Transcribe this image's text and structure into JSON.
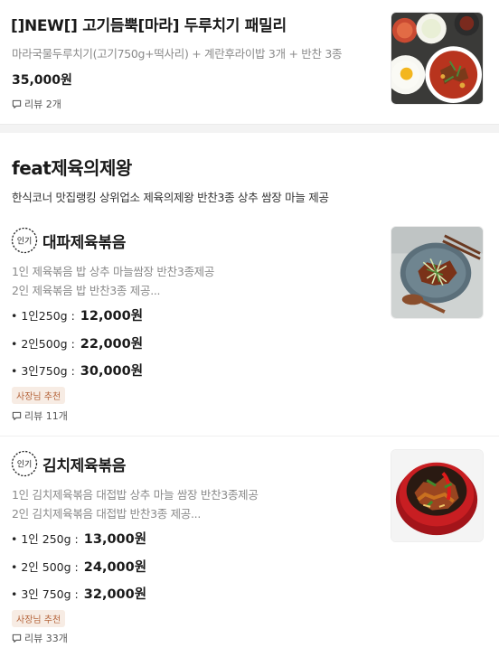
{
  "top_item": {
    "title": "[]NEW[] 고기듬뿍[마라] 두루치기 패밀리",
    "description": "마라국물두루치기(고기750g+떡사리) + 계란후라이밥 3개 + 반찬 3종",
    "price": "35,000원",
    "review": "리뷰 2개"
  },
  "section": {
    "title": "feat제육의제왕",
    "description": "한식코너 맛집랭킹 상위업소 제육의제왕  반찬3종 상추 쌈장 마늘 제공"
  },
  "menu_items": [
    {
      "badge": "인기",
      "title": "대파제육볶음",
      "description_lines": [
        "1인 제육볶음 밥 상추 마늘쌈장 반찬3종제공",
        "2인 제육볶음 밥 반찬3종 제공..."
      ],
      "options": [
        {
          "label": "• 1인250g :",
          "price": "12,000원"
        },
        {
          "label": "• 2인500g :",
          "price": "22,000원"
        },
        {
          "label": "• 3인750g :",
          "price": "30,000원"
        }
      ],
      "owner_badge": "사장님 추천",
      "review": "리뷰 11개"
    },
    {
      "badge": "인기",
      "title": "김치제육볶음",
      "description_lines": [
        "1인 김치제육볶음 대접밥 상추 마늘 쌈장 반찬3종제공",
        "2인 김치제육볶음 대접밥 반찬3종 제공..."
      ],
      "options": [
        {
          "label": "• 1인 250g :",
          "price": "13,000원"
        },
        {
          "label": "• 2인 500g :",
          "price": "24,000원"
        },
        {
          "label": "• 3인 750g :",
          "price": "32,000원"
        }
      ],
      "owner_badge": "사장님 추천",
      "review": "리뷰 33개"
    }
  ],
  "colors": {
    "owner_badge_text": "#b5643a",
    "owner_badge_bg": "#f7ece4",
    "divider": "#f3f3f3"
  }
}
